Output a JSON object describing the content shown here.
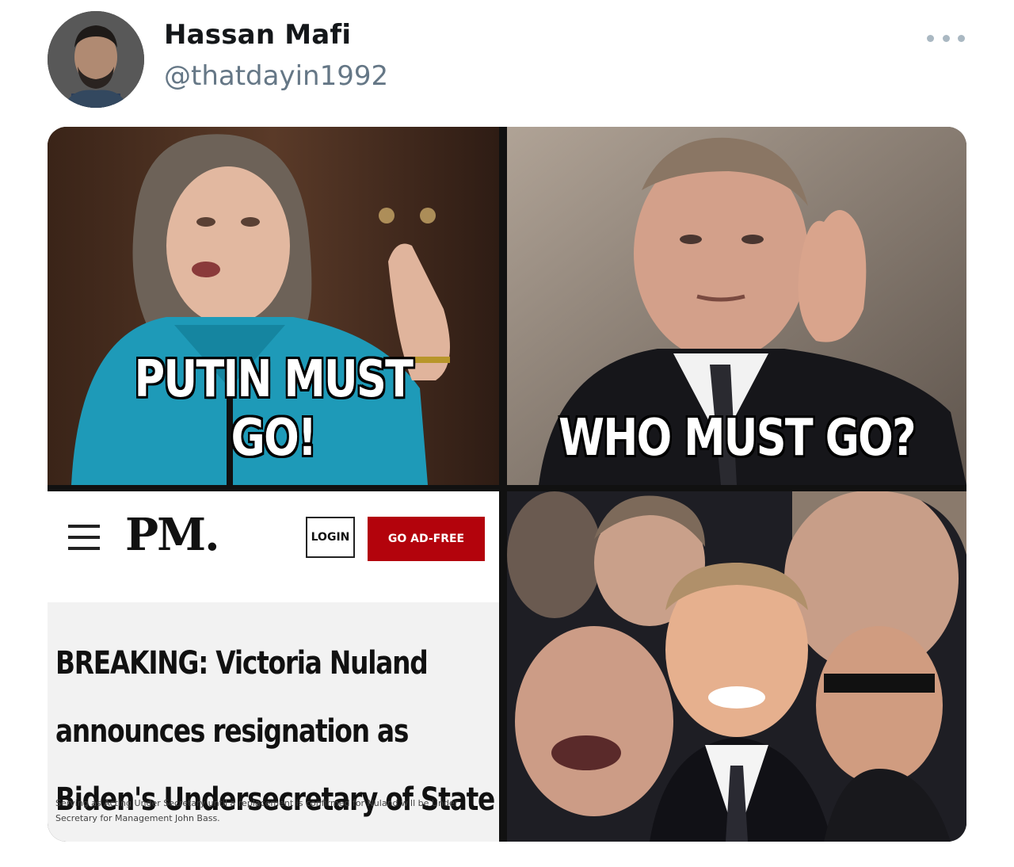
{
  "tweet": {
    "user": {
      "display_name": "Hassan Mafi",
      "handle": "@thatdayin1992",
      "avatar_icon": "profile-photo"
    },
    "more_icon": "ellipsis-icon"
  },
  "meme": {
    "panel1_caption": "PUTIN MUST GO!",
    "panel2_caption": "WHO MUST GO?",
    "news": {
      "logo": "PM.",
      "login_label": "LOGIN",
      "adfree_label": "GO AD-FREE",
      "headline_lines": [
        "BREAKING: Victoria Nuland",
        "announces resignation as",
        "Biden's Undersecretary of State"
      ],
      "subtext": "Serving as Acting Under Secretary until a replacement is confirmed for Nuland will be Under Secretary for Management John Bass."
    }
  },
  "colors": {
    "handle_gray": "#657786",
    "accent_red": "#b3030c",
    "caption_white": "#ffffff"
  }
}
